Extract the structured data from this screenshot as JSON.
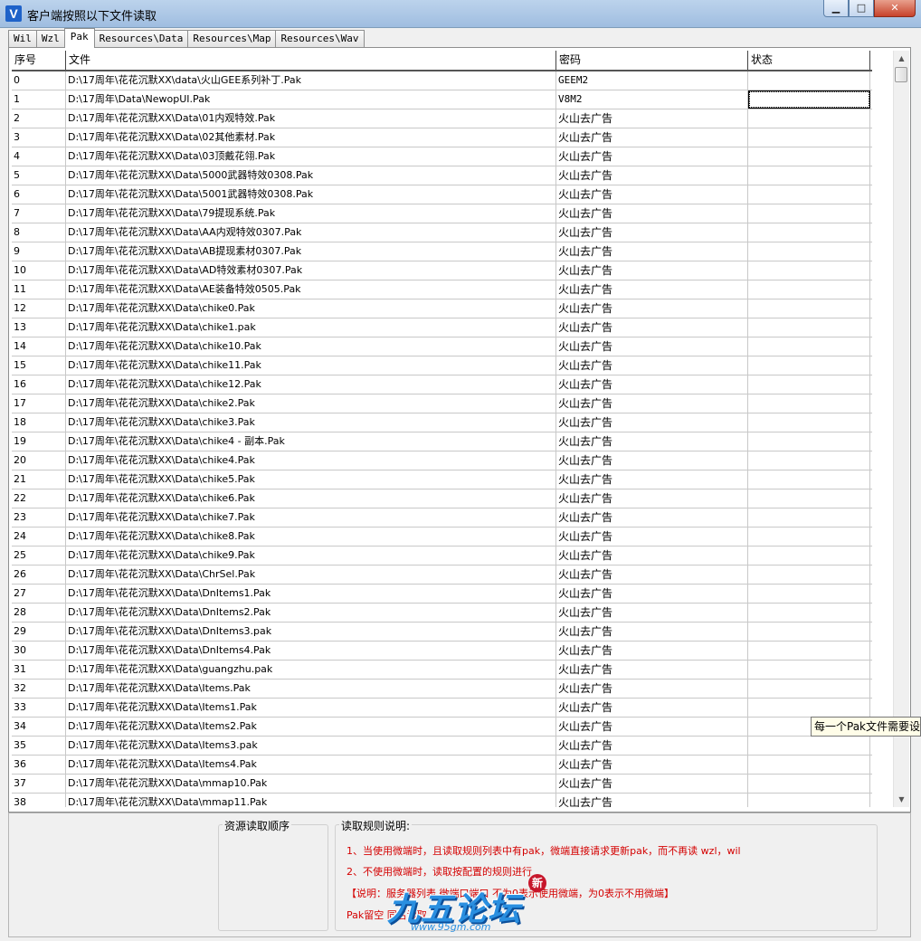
{
  "window": {
    "title": "客户端按照以下文件读取",
    "icon_glyph": "V",
    "minimize_glyph": "▁",
    "maximize_glyph": "□",
    "close_glyph": "✕"
  },
  "tabs": [
    {
      "label": "Wil"
    },
    {
      "label": "Wzl"
    },
    {
      "label": "Pak",
      "active": true
    },
    {
      "label": "Resources\\Data"
    },
    {
      "label": "Resources\\Map"
    },
    {
      "label": "Resources\\Wav"
    }
  ],
  "grid": {
    "columns": [
      "序号",
      "文件",
      "密码",
      "状态"
    ],
    "rows": [
      {
        "index": "0",
        "file": "D:\\17周年\\花花沉默XX\\data\\火山GEE系列补丁.Pak",
        "password": "GEEM2",
        "status": ""
      },
      {
        "index": "1",
        "file": "D:\\17周年\\Data\\NewopUI.Pak",
        "password": "V8M2",
        "status": ""
      },
      {
        "index": "2",
        "file": "D:\\17周年\\花花沉默XX\\Data\\01内观特效.Pak",
        "password": "火山去广告",
        "status": ""
      },
      {
        "index": "3",
        "file": "D:\\17周年\\花花沉默XX\\Data\\02其他素材.Pak",
        "password": "火山去广告",
        "status": ""
      },
      {
        "index": "4",
        "file": "D:\\17周年\\花花沉默XX\\Data\\03顶戴花翎.Pak",
        "password": "火山去广告",
        "status": ""
      },
      {
        "index": "5",
        "file": "D:\\17周年\\花花沉默XX\\Data\\5000武器特效0308.Pak",
        "password": "火山去广告",
        "status": ""
      },
      {
        "index": "6",
        "file": "D:\\17周年\\花花沉默XX\\Data\\5001武器特效0308.Pak",
        "password": "火山去广告",
        "status": ""
      },
      {
        "index": "7",
        "file": "D:\\17周年\\花花沉默XX\\Data\\79提现系统.Pak",
        "password": "火山去广告",
        "status": ""
      },
      {
        "index": "8",
        "file": "D:\\17周年\\花花沉默XX\\Data\\AA内观特效0307.Pak",
        "password": "火山去广告",
        "status": ""
      },
      {
        "index": "9",
        "file": "D:\\17周年\\花花沉默XX\\Data\\AB提现素材0307.Pak",
        "password": "火山去广告",
        "status": ""
      },
      {
        "index": "10",
        "file": "D:\\17周年\\花花沉默XX\\Data\\AD特效素材0307.Pak",
        "password": "火山去广告",
        "status": ""
      },
      {
        "index": "11",
        "file": "D:\\17周年\\花花沉默XX\\Data\\AE装备特效0505.Pak",
        "password": "火山去广告",
        "status": ""
      },
      {
        "index": "12",
        "file": "D:\\17周年\\花花沉默XX\\Data\\chike0.Pak",
        "password": "火山去广告",
        "status": ""
      },
      {
        "index": "13",
        "file": "D:\\17周年\\花花沉默XX\\Data\\chike1.pak",
        "password": "火山去广告",
        "status": ""
      },
      {
        "index": "14",
        "file": "D:\\17周年\\花花沉默XX\\Data\\chike10.Pak",
        "password": "火山去广告",
        "status": ""
      },
      {
        "index": "15",
        "file": "D:\\17周年\\花花沉默XX\\Data\\chike11.Pak",
        "password": "火山去广告",
        "status": ""
      },
      {
        "index": "16",
        "file": "D:\\17周年\\花花沉默XX\\Data\\chike12.Pak",
        "password": "火山去广告",
        "status": ""
      },
      {
        "index": "17",
        "file": "D:\\17周年\\花花沉默XX\\Data\\chike2.Pak",
        "password": "火山去广告",
        "status": ""
      },
      {
        "index": "18",
        "file": "D:\\17周年\\花花沉默XX\\Data\\chike3.Pak",
        "password": "火山去广告",
        "status": ""
      },
      {
        "index": "19",
        "file": "D:\\17周年\\花花沉默XX\\Data\\chike4 - 副本.Pak",
        "password": "火山去广告",
        "status": ""
      },
      {
        "index": "20",
        "file": "D:\\17周年\\花花沉默XX\\Data\\chike4.Pak",
        "password": "火山去广告",
        "status": ""
      },
      {
        "index": "21",
        "file": "D:\\17周年\\花花沉默XX\\Data\\chike5.Pak",
        "password": "火山去广告",
        "status": ""
      },
      {
        "index": "22",
        "file": "D:\\17周年\\花花沉默XX\\Data\\chike6.Pak",
        "password": "火山去广告",
        "status": ""
      },
      {
        "index": "23",
        "file": "D:\\17周年\\花花沉默XX\\Data\\chike7.Pak",
        "password": "火山去广告",
        "status": ""
      },
      {
        "index": "24",
        "file": "D:\\17周年\\花花沉默XX\\Data\\chike8.Pak",
        "password": "火山去广告",
        "status": ""
      },
      {
        "index": "25",
        "file": "D:\\17周年\\花花沉默XX\\Data\\chike9.Pak",
        "password": "火山去广告",
        "status": ""
      },
      {
        "index": "26",
        "file": "D:\\17周年\\花花沉默XX\\Data\\ChrSel.Pak",
        "password": "火山去广告",
        "status": ""
      },
      {
        "index": "27",
        "file": "D:\\17周年\\花花沉默XX\\Data\\DnItems1.Pak",
        "password": "火山去广告",
        "status": ""
      },
      {
        "index": "28",
        "file": "D:\\17周年\\花花沉默XX\\Data\\DnItems2.Pak",
        "password": "火山去广告",
        "status": ""
      },
      {
        "index": "29",
        "file": "D:\\17周年\\花花沉默XX\\Data\\DnItems3.pak",
        "password": "火山去广告",
        "status": ""
      },
      {
        "index": "30",
        "file": "D:\\17周年\\花花沉默XX\\Data\\DnItems4.Pak",
        "password": "火山去广告",
        "status": ""
      },
      {
        "index": "31",
        "file": "D:\\17周年\\花花沉默XX\\Data\\guangzhu.pak",
        "password": "火山去广告",
        "status": ""
      },
      {
        "index": "32",
        "file": "D:\\17周年\\花花沉默XX\\Data\\Items.Pak",
        "password": "火山去广告",
        "status": ""
      },
      {
        "index": "33",
        "file": "D:\\17周年\\花花沉默XX\\Data\\Items1.Pak",
        "password": "火山去广告",
        "status": ""
      },
      {
        "index": "34",
        "file": "D:\\17周年\\花花沉默XX\\Data\\Items2.Pak",
        "password": "火山去广告",
        "status": ""
      },
      {
        "index": "35",
        "file": "D:\\17周年\\花花沉默XX\\Data\\Items3.pak",
        "password": "火山去广告",
        "status": ""
      },
      {
        "index": "36",
        "file": "D:\\17周年\\花花沉默XX\\Data\\Items4.Pak",
        "password": "火山去广告",
        "status": ""
      },
      {
        "index": "37",
        "file": "D:\\17周年\\花花沉默XX\\Data\\mmap10.Pak",
        "password": "火山去广告",
        "status": ""
      },
      {
        "index": "38",
        "file": "D:\\17周年\\花花沉默XX\\Data\\mmap11.Pak",
        "password": "火山去广告",
        "status": ""
      }
    ]
  },
  "tooltip": {
    "text": "每一个Pak文件需要设"
  },
  "bottom": {
    "order_title": "资源读取顺序",
    "rules_title": "读取规则说明:",
    "rules": [
      "1、当使用微端时，且读取规则列表中有pak，微端直接请求更新pak，而不再读 wzl，wil",
      "2、不使用微端时，读取按配置的规则进行",
      "【说明：服务器列表 微端口端口  不为0表示使用微端，为0表示不用微端】",
      "Pak留空 同名读取"
    ]
  },
  "watermark": {
    "text": "九五论坛",
    "url": "www.95gm.com",
    "badge": "新"
  },
  "colors": {
    "rule_text": "#d40000",
    "tooltip_bg": "#fffde8",
    "title_bar": "#bcd3ec",
    "watermark": "#2a8fe0"
  }
}
